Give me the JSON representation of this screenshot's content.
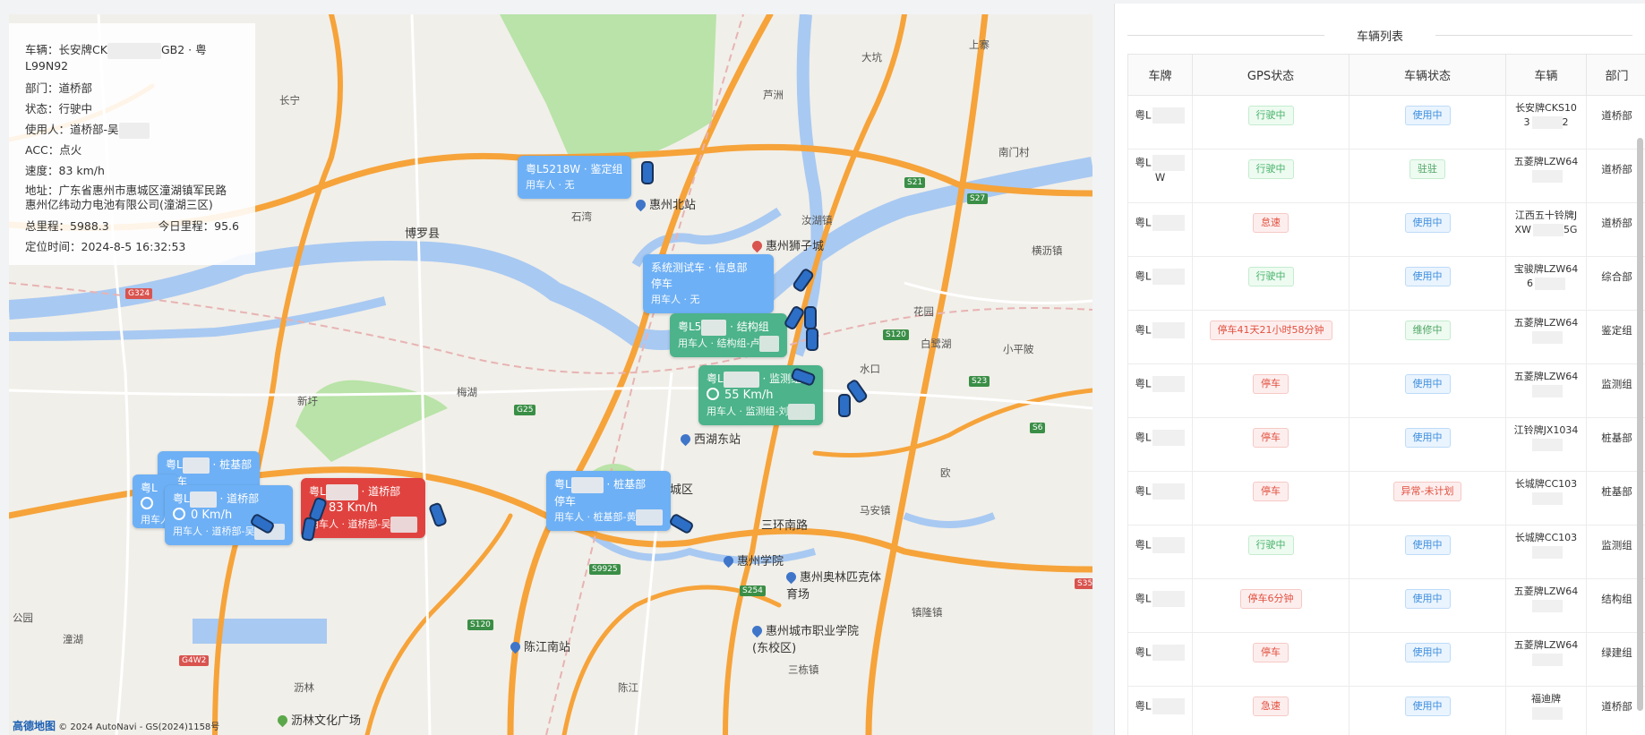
{
  "info": {
    "vehicle": "车辆：长安牌CK",
    "vehicle_tail": "GB2 · 粤",
    "vehicle_line2": "L99N92",
    "dept": "部门：道桥部",
    "status": "状态：行驶中",
    "user": "使用人：道桥部-吴",
    "acc": "ACC：点火",
    "speed": "速度：83 km/h",
    "address1": "地址：广东省惠州市惠城区潼湖镇军民路",
    "address2": "惠州亿纬动力电池有限公司(潼湖三区)",
    "total_mileage": "总里程：5988.3",
    "today_mileage": "今日里程：95.6",
    "locate_time": "定位时间：2024-8-5 16:32:53"
  },
  "bubbles": [
    {
      "id": "b1",
      "title": "粤L5218W · 鉴定组",
      "sub": "用车人 · 无"
    },
    {
      "id": "b2",
      "title": "系统测试车 · 信息部",
      "line2": "停车",
      "sub": "用车人 · 无"
    },
    {
      "id": "b3",
      "title": "粤L5",
      "title_tail": "· 结构组",
      "sub": "用车人 · 结构组-卢"
    },
    {
      "id": "b4",
      "title": "粤L",
      "title_tail": "· 监测组",
      "speed": "55 Km/h",
      "sub": "用车人 · 监测组-刘"
    },
    {
      "id": "b5",
      "title": "粤L",
      "title_tail": "· 桩基部",
      "line2": "停车",
      "sub": "用车人 · 桩基部-黄"
    },
    {
      "id": "b6",
      "title": "粤L",
      "title_tail": "· 道桥部",
      "speed": "83 Km/h",
      "sub": "用车人 · 道桥部-吴"
    },
    {
      "id": "b7",
      "title": "粤L",
      "title_tail": "· 道桥部",
      "speed": "0 Km/h",
      "sub": "用车人 · 道桥部-吴"
    },
    {
      "id": "b8",
      "title": "粤L",
      "title_tail": "· 桩基部",
      "line2": "停车"
    },
    {
      "id": "b9",
      "title": "粤L",
      "sub": "用车人"
    }
  ],
  "map_labels": {
    "l1": "惠州北站",
    "l2": "惠州狮子城",
    "l3": "西湖东站",
    "l4": "惠城区",
    "l5": "三环南路",
    "l6": "惠州学院",
    "l7": "惠州奥林匹克体育场",
    "l8": "惠州城市职业学院(东校区)",
    "l9": "陈江南站",
    "l10": "沥林文化广场",
    "l11": "博罗县",
    "l12": "汝湖镇",
    "l13": "长宁",
    "l14": "石湾",
    "l15": "新圩",
    "l16": "镇隆镇",
    "l17": "三栋镇",
    "l18": "马安镇",
    "l19": "水口",
    "l20": "沥林",
    "l21": "陈江",
    "l22": "潼湖",
    "l23": "芦洲",
    "l24": "大坑",
    "l25": "上寨",
    "l26": "南门村",
    "l27": "横沥镇",
    "l28": "梅湖",
    "l29": "欧",
    "l30": "白鹭湖",
    "l31": "汝湖镇",
    "l32": "小平陂",
    "l33": "花园",
    "l34": "公园"
  },
  "road_tags": [
    "S21",
    "S27",
    "S120",
    "S9925",
    "G25",
    "G324",
    "S254",
    "S120",
    "S6",
    "G4W2",
    "S357",
    "S23"
  ],
  "attribution": {
    "logo": "高德地图",
    "text": "© 2024 AutoNavi - GS(2024)1158号"
  },
  "list": {
    "title": "车辆列表",
    "columns": [
      "车牌",
      "GPS状态",
      "车辆状态",
      "车辆",
      "部门"
    ],
    "rows": [
      {
        "plate": "粤L",
        "gps": "行驶中",
        "gps_type": "green",
        "status": "使用中",
        "status_type": "blue",
        "car": "长安牌CKS10",
        "car2": "3",
        "car2_tail": "2",
        "dept": "道桥部"
      },
      {
        "plate": "粤L",
        "plate2": "W",
        "gps": "行驶中",
        "gps_type": "green",
        "status": "驻驻",
        "status_type": "dark",
        "car": "五菱牌LZW64",
        "car2": "",
        "dept": "道桥部"
      },
      {
        "plate": "粤L",
        "gps": "怠速",
        "gps_type": "red",
        "status": "使用中",
        "status_type": "blue",
        "car": "江西五十铃牌J",
        "car2": "XW",
        "car2_tail": "5G",
        "dept": "道桥部"
      },
      {
        "plate": "粤L",
        "gps": "行驶中",
        "gps_type": "green",
        "status": "使用中",
        "status_type": "blue",
        "car": "宝骏牌LZW64",
        "car2": "6",
        "dept": "综合部"
      },
      {
        "plate": "粤L",
        "gps": "停车41天21小时58分钟",
        "gps_type": "red",
        "status": "维修中",
        "status_type": "dark",
        "car": "五菱牌LZW64",
        "car2": "",
        "dept": "鉴定组"
      },
      {
        "plate": "粤L",
        "gps": "停车",
        "gps_type": "red",
        "status": "使用中",
        "status_type": "blue",
        "car": "五菱牌LZW64",
        "car2": "",
        "dept": "监测组"
      },
      {
        "plate": "粤L",
        "gps": "停车",
        "gps_type": "red",
        "status": "使用中",
        "status_type": "blue",
        "car": "江铃牌JX1034",
        "car2": "",
        "dept": "桩基部"
      },
      {
        "plate": "粤L",
        "gps": "停车",
        "gps_type": "red",
        "status": "异常-未计划",
        "status_type": "red",
        "car": "长城牌CC103",
        "car2": "",
        "dept": "桩基部"
      },
      {
        "plate": "粤L",
        "gps": "行驶中",
        "gps_type": "green",
        "status": "使用中",
        "status_type": "blue",
        "car": "长城牌CC103",
        "car2": "",
        "dept": "监测组"
      },
      {
        "plate": "粤L",
        "gps": "停车6分钟",
        "gps_type": "red",
        "status": "使用中",
        "status_type": "blue",
        "car": "五菱牌LZW64",
        "car2": "",
        "dept": "结构组"
      },
      {
        "plate": "粤L",
        "gps": "停车",
        "gps_type": "red",
        "status": "使用中",
        "status_type": "blue",
        "car": "五菱牌LZW64",
        "car2": "",
        "dept": "绿建组"
      },
      {
        "plate": "粤L",
        "gps": "急速",
        "gps_type": "red",
        "status": "使用中",
        "status_type": "blue",
        "car": "福迪牌",
        "car2": "",
        "dept": "道桥部"
      }
    ]
  },
  "colors": {
    "road_major": "#f6a33a",
    "river": "#a8c9f2",
    "park": "#b9e3a8",
    "bubble_blue": "#6eb0f5",
    "bubble_green": "#4cb38a",
    "bubble_red": "#e0433f"
  }
}
